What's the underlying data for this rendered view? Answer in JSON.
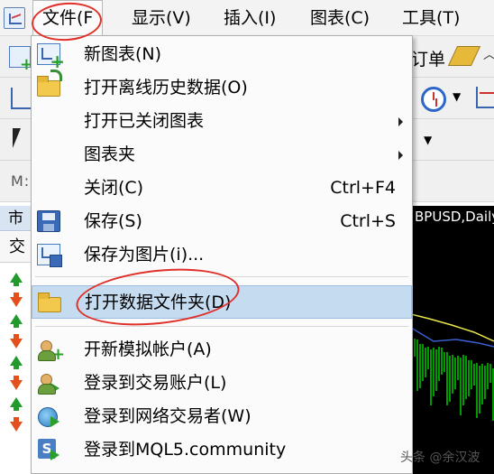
{
  "menubar": {
    "items": [
      {
        "label": "文件(F"
      },
      {
        "label": "显示(V)"
      },
      {
        "label": "插入(I)"
      },
      {
        "label": "图表(C)"
      },
      {
        "label": "工具(T)"
      }
    ]
  },
  "toolbar": {
    "order_label": "订单",
    "m_label": "M:"
  },
  "market_watch": {
    "title": "市",
    "column": "交",
    "rows": [
      "up",
      "down",
      "up",
      "down",
      "up",
      "down",
      "up",
      "down"
    ]
  },
  "chart": {
    "title": "BPUSD,Daily",
    "background": "#000000",
    "candle_color": "#00cc00"
  },
  "file_menu": {
    "items": [
      {
        "label": "新图表(N)",
        "shortcut": "",
        "submenu": false,
        "icon": "new-chart-icon"
      },
      {
        "label": "打开离线历史数据(O)",
        "shortcut": "",
        "submenu": false,
        "icon": "open-folder-icon"
      },
      {
        "label": "打开已关闭图表",
        "shortcut": "",
        "submenu": true,
        "icon": ""
      },
      {
        "label": "图表夹",
        "shortcut": "",
        "submenu": true,
        "icon": ""
      },
      {
        "label": "关闭(C)",
        "shortcut": "Ctrl+F4",
        "submenu": false,
        "icon": ""
      },
      {
        "label": "保存(S)",
        "shortcut": "Ctrl+S",
        "submenu": false,
        "icon": "save-icon"
      },
      {
        "label": "保存为图片(i)...",
        "shortcut": "",
        "submenu": false,
        "icon": "save-image-icon"
      },
      {
        "label": "打开数据文件夹(D)",
        "shortcut": "",
        "submenu": false,
        "icon": "folder-icon",
        "highlighted": true
      },
      {
        "label": "开新模拟帐户(A)",
        "shortcut": "",
        "submenu": false,
        "icon": "new-account-icon"
      },
      {
        "label": "登录到交易账户(L)",
        "shortcut": "",
        "submenu": false,
        "icon": "login-account-icon"
      },
      {
        "label": "登录到网络交易者(W)",
        "shortcut": "",
        "submenu": false,
        "icon": "web-trader-icon"
      },
      {
        "label": "登录到MQL5.community",
        "shortcut": "",
        "submenu": false,
        "icon": "mql5-icon"
      }
    ]
  },
  "watermark": "头条 @余汉波",
  "colors": {
    "highlight": "#c5dbf0",
    "annotation_circle": "#e0302a",
    "up_arrow": "#1f9a2b",
    "down_arrow": "#e4501c"
  }
}
